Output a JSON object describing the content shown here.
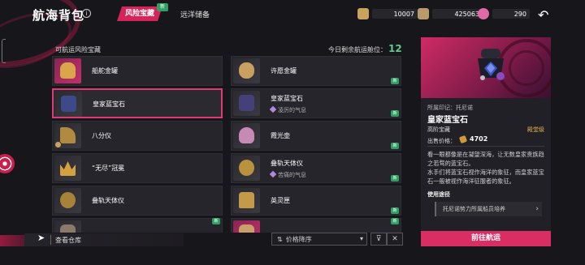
{
  "header": {
    "title": "航海背包",
    "info_icon": "i",
    "tabs": [
      {
        "label": "风险宝藏",
        "active": true,
        "new_badge": "新"
      },
      {
        "label": "远洋储备",
        "active": false
      }
    ],
    "resources": [
      {
        "icon": "treasure-chest-icon",
        "value": "10007",
        "color": "#c9a35e"
      },
      {
        "icon": "coin-bag-icon",
        "value": "425063",
        "color": "#b99a6a"
      },
      {
        "icon": "pink-gem-icon",
        "value": "290",
        "color": "#e06aa4"
      }
    ],
    "back_icon": "↶"
  },
  "list": {
    "section_label": "可航运风险宝藏",
    "capacity_label": "今日剩余航运舱位：",
    "capacity_value": "12",
    "items": [
      {
        "name": "船舵金罐",
        "sub": "",
        "tint": "pink",
        "badge": "",
        "pin": false
      },
      {
        "name": "许愿金罐",
        "sub": "",
        "tint": "dark",
        "badge": "新",
        "pin": false
      },
      {
        "name": "皇家蓝宝石",
        "sub": "",
        "tint": "dark",
        "badge": "",
        "pin": false,
        "selected": true
      },
      {
        "name": "皇家蓝宝石",
        "sub": "凌厉的气息",
        "tint": "dark",
        "badge": "新",
        "pin": false
      },
      {
        "name": "八分仪",
        "sub": "",
        "tint": "dark",
        "badge": "",
        "pin": true
      },
      {
        "name": "霞光壶",
        "sub": "",
        "tint": "dark",
        "badge": "新",
        "pin": false
      },
      {
        "name": "“无尽”冠冕",
        "sub": "",
        "tint": "dark",
        "badge": "",
        "pin": false
      },
      {
        "name": "叠轨天体仪",
        "sub": "苦痛的气息",
        "tint": "dark",
        "badge": "新",
        "pin": false
      },
      {
        "name": "叠轨天体仪",
        "sub": "",
        "tint": "dark",
        "badge": "",
        "pin": false
      },
      {
        "name": "英灵匣",
        "sub": "",
        "tint": "dark",
        "badge": "新",
        "pin": false
      },
      {
        "name": "",
        "sub": "",
        "tint": "dark",
        "badge": "新",
        "pin": false
      },
      {
        "name": "",
        "sub": "",
        "tint": "pink",
        "badge": "新",
        "pin": false
      }
    ]
  },
  "bottom": {
    "view_warehouse": "查看仓库",
    "sort_label": "价格降序",
    "filter_icon": "⊽",
    "close_icon": "✕"
  },
  "detail": {
    "origin": "所属印记：托尼诺",
    "name": "皇家蓝宝石",
    "grade": "高阶宝藏",
    "rarity": "殿堂级",
    "price_label": "出售价格：",
    "price": "4702",
    "description": "看一眼都像是在凝望深海，让无数皇家贵族趋之若骛的蓝宝石。\n水手们将蓝宝石视作海洋的象征，而皇家蓝宝石一般被视作海洋征服者的象征。",
    "usage_title": "使用途径",
    "usage_item": "托尼诺势力所属船员培养",
    "action_button": "前往航运"
  },
  "colors": {
    "accent": "#d82e64",
    "new_badge": "#2fa064",
    "capacity": "#5fc98e",
    "rarity": "#e6b24c"
  }
}
